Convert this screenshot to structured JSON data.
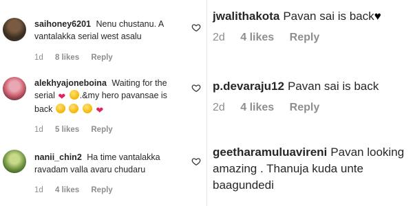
{
  "left_comments": [
    {
      "username": "saihoney6201",
      "text": "Nenu chustanu. A vantalakka serial west asalu",
      "age": "1d",
      "likes": "8 likes",
      "reply_label": "Reply",
      "avatar_colors": [
        "#3a2f22",
        "#7a5a40"
      ]
    },
    {
      "username": "alekhyajoneboina",
      "text_before": "Waiting for the serial",
      "text_after": ".&my hero pavansae is back",
      "age": "1d",
      "likes": "5 likes",
      "reply_label": "Reply",
      "avatar_colors": [
        "#c95a6a",
        "#e8a7b2"
      ]
    },
    {
      "username": "nanii_chin2",
      "text": "Ha time vantalakka ravadam valla avaru chudaru",
      "age": "1d",
      "likes": "4 likes",
      "reply_label": "Reply",
      "avatar_colors": [
        "#6b8f3e",
        "#c9d98a"
      ]
    }
  ],
  "right_comments": [
    {
      "username": "jwalithakota",
      "text": "Pavan sai is back",
      "age": "2d",
      "likes": "4 likes",
      "reply_label": "Reply"
    },
    {
      "username": "p.devaraju12",
      "text": "Pavan sai is back",
      "age": "2d",
      "likes": "4 likes",
      "reply_label": "Reply"
    },
    {
      "username": "geetharamuluavireni",
      "text": "Pavan looking amazing . Thanuja kuda unte baagundedi"
    }
  ],
  "icons": {
    "like": "heart-outline-icon",
    "heart_emoji": "red-heart-emoji",
    "face_emoji": "smiling-face-emoji",
    "black_heart": "black-heart-emoji"
  },
  "colors": {
    "text": "#262626",
    "meta": "#8e8e8e",
    "heart": "#e0245e"
  }
}
